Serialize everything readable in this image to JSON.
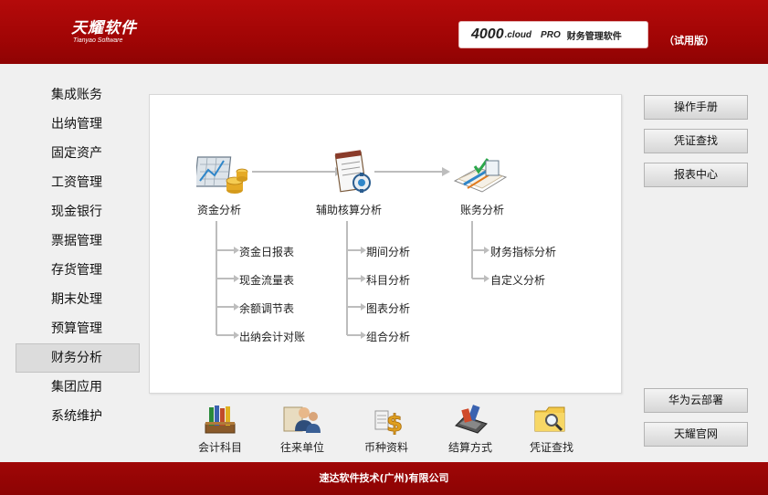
{
  "header": {
    "logo_main": "天耀软件",
    "logo_sub": "Tianyao Software",
    "product_brand": "4000",
    "product_cloud": ".cloud",
    "product_pro": "PRO",
    "product_name": "财务管理软件",
    "trial": "（试用版）"
  },
  "nav": {
    "active_index": 9,
    "items": [
      "集成账务",
      "出纳管理",
      "固定资产",
      "工资管理",
      "现金银行",
      "票据管理",
      "存货管理",
      "期末处理",
      "预算管理",
      "财务分析",
      "集团应用",
      "系统维护"
    ]
  },
  "flow": {
    "modules": [
      {
        "label": "资金分析",
        "icon": "fund-analysis-icon"
      },
      {
        "label": "辅助核算分析",
        "icon": "auxiliary-accounting-icon"
      },
      {
        "label": "账务分析",
        "icon": "accounts-analysis-icon"
      }
    ],
    "fund_subs": [
      "资金日报表",
      "现金流量表",
      "余额调节表",
      "出纳会计对账"
    ],
    "aux_subs": [
      "期间分析",
      "科目分析",
      "图表分析",
      "组合分析"
    ],
    "acct_subs": [
      "财务指标分析",
      "自定义分析"
    ]
  },
  "tools": [
    {
      "label": "会计科目",
      "icon": "ledger-books-icon"
    },
    {
      "label": "往来单位",
      "icon": "contacts-people-icon"
    },
    {
      "label": "币种资料",
      "icon": "currency-icon"
    },
    {
      "label": "结算方式",
      "icon": "pos-terminal-icon"
    },
    {
      "label": "凭证查找",
      "icon": "folder-search-icon"
    }
  ],
  "right_buttons_top": [
    "操作手册",
    "凭证查找",
    "报表中心"
  ],
  "right_buttons_bottom": [
    "华为云部署",
    "天耀官网"
  ],
  "footer": {
    "company": "速达软件技术(广州)有限公司"
  },
  "colors": {
    "brand_red": "#a10505",
    "arrow_gray": "#bdbdbd"
  }
}
